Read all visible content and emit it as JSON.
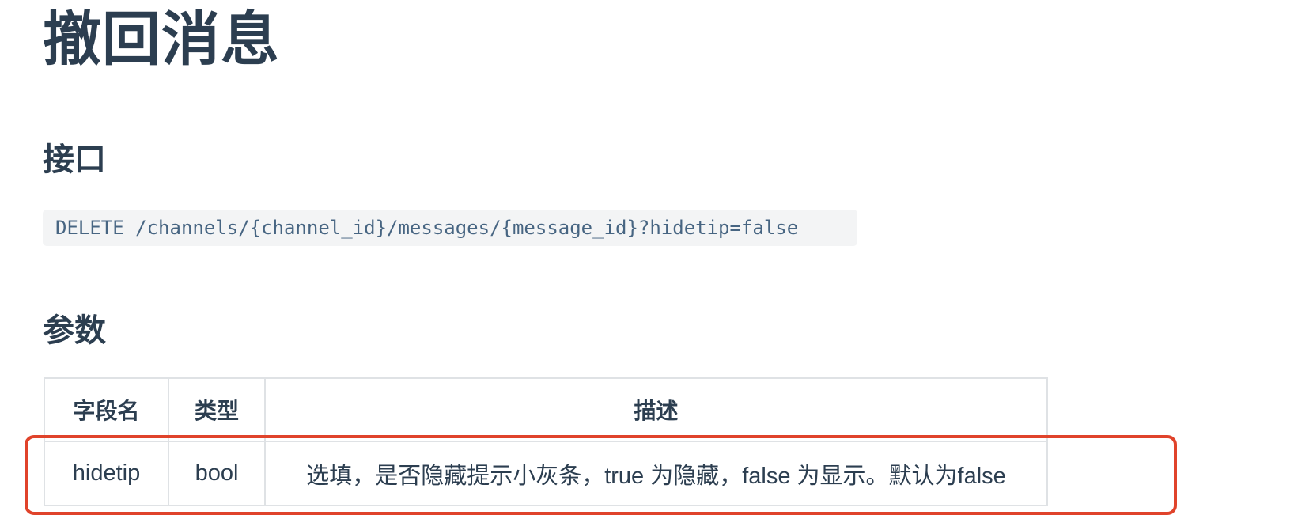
{
  "page": {
    "title": "撤回消息"
  },
  "endpoint": {
    "heading": "接口",
    "code": "DELETE /channels/{channel_id}/messages/{message_id}?hidetip=false"
  },
  "params": {
    "heading": "参数",
    "columns": [
      "字段名",
      "类型",
      "描述"
    ],
    "rows": [
      [
        "hidetip",
        "bool",
        "选填，是否隐藏提示小灰条，true 为隐藏，false 为显示。默认为false"
      ]
    ]
  },
  "colors": {
    "text": "#2c3e50",
    "code_text": "#476582",
    "code_background": "#f3f4f5",
    "table_border": "#dfe2e5",
    "highlight": "#e0432b"
  }
}
